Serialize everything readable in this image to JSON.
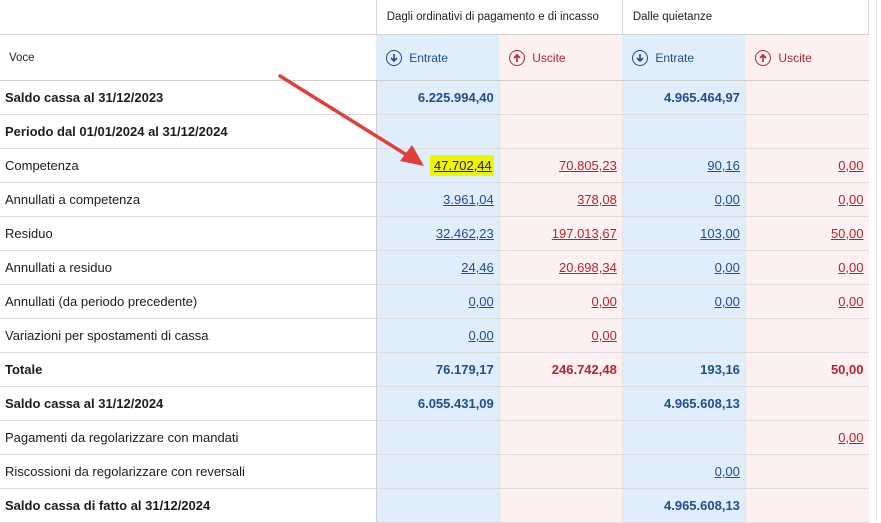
{
  "header": {
    "group1": "Dagli ordinativi di pagamento e di incasso",
    "group2": "Dalle quietanze",
    "voce": "Voce",
    "entrate": "Entrate",
    "uscite": "Uscite"
  },
  "colors": {
    "entrate_accent": "#1e4f8c",
    "uscite_accent": "#b3262f",
    "entrate_bg": "#e0eefb",
    "uscite_bg": "#fdf0f1",
    "highlight": "#eef502",
    "annotation_arrow": "#e0403a"
  },
  "rows": [
    {
      "label": "Saldo cassa al 31/12/2023",
      "bold": true,
      "vals": [
        "6.225.994,40",
        "",
        "4.965.464,97",
        ""
      ],
      "links": false
    },
    {
      "label": "Periodo dal 01/01/2024 al 31/12/2024",
      "bold": true,
      "vals": [
        "",
        "",
        "",
        ""
      ],
      "links": false
    },
    {
      "label": "Competenza",
      "bold": false,
      "vals": [
        "47.702,44",
        "70.805,23",
        "90,16",
        "0,00"
      ],
      "links": true,
      "highlight": 0
    },
    {
      "label": "Annullati a competenza",
      "bold": false,
      "vals": [
        "3.961,04",
        "378,08",
        "0,00",
        "0,00"
      ],
      "links": true
    },
    {
      "label": "Residuo",
      "bold": false,
      "vals": [
        "32.462,23",
        "197.013,67",
        "103,00",
        "50,00"
      ],
      "links": true
    },
    {
      "label": "Annullati a residuo",
      "bold": false,
      "vals": [
        "24,46",
        "20.698,34",
        "0,00",
        "0,00"
      ],
      "links": true
    },
    {
      "label": "Annullati (da periodo precedente)",
      "bold": false,
      "vals": [
        "0,00",
        "0,00",
        "0,00",
        "0,00"
      ],
      "links": true
    },
    {
      "label": "Variazioni per spostamenti di cassa",
      "bold": false,
      "vals": [
        "0,00",
        "0,00",
        "",
        ""
      ],
      "links": true
    },
    {
      "label": "Totale",
      "bold": true,
      "vals": [
        "76.179,17",
        "246.742,48",
        "193,16",
        "50,00"
      ],
      "links": false
    },
    {
      "label": "Saldo cassa al 31/12/2024",
      "bold": true,
      "vals": [
        "6.055.431,09",
        "",
        "4.965.608,13",
        ""
      ],
      "links": false
    },
    {
      "label": "Pagamenti da regolarizzare con mandati",
      "bold": false,
      "vals": [
        "",
        "",
        "",
        "0,00"
      ],
      "links": true
    },
    {
      "label": "Riscossioni da regolarizzare con reversali",
      "bold": false,
      "vals": [
        "",
        "",
        "0,00",
        ""
      ],
      "links": true
    },
    {
      "label": "Saldo cassa di fatto al 31/12/2024",
      "bold": true,
      "vals": [
        "",
        "",
        "4.965.608,13",
        ""
      ],
      "links": false
    }
  ]
}
